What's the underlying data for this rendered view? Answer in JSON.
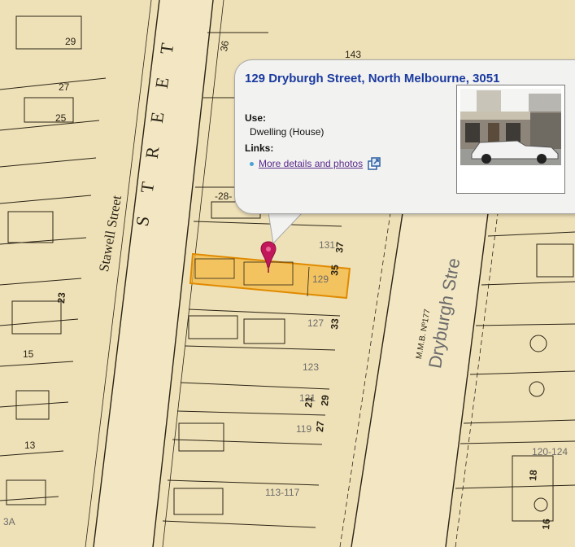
{
  "map": {
    "street_labels": [
      "Stawell Street",
      "S T R E E T",
      "Dryburgh Stre"
    ],
    "lot_numbers": [
      "29",
      "27",
      "25",
      "15",
      "13",
      "143",
      "36",
      "-28-",
      "131",
      "129",
      "127",
      "123",
      "121",
      "119",
      "113-117",
      "120-124",
      "3A",
      "35",
      "37",
      "33",
      "29",
      "27",
      "23",
      "18",
      "16",
      "21"
    ],
    "survey_mark": "M.M.B. Nº177",
    "colors": {
      "parcel_fill": "#f5b63a",
      "parcel_border": "#e08a00",
      "pin": "#c2185b",
      "paper": "#efe1b7",
      "ink": "#2a2416"
    }
  },
  "popup": {
    "title": "129 Dryburgh Street, North Melbourne, 3051",
    "use_label": "Use:",
    "use_value": "Dwelling (House)",
    "links_label": "Links:",
    "link_text": "More details and photos",
    "link_icon": "external-window-icon",
    "photo_icon": "house-photo"
  }
}
